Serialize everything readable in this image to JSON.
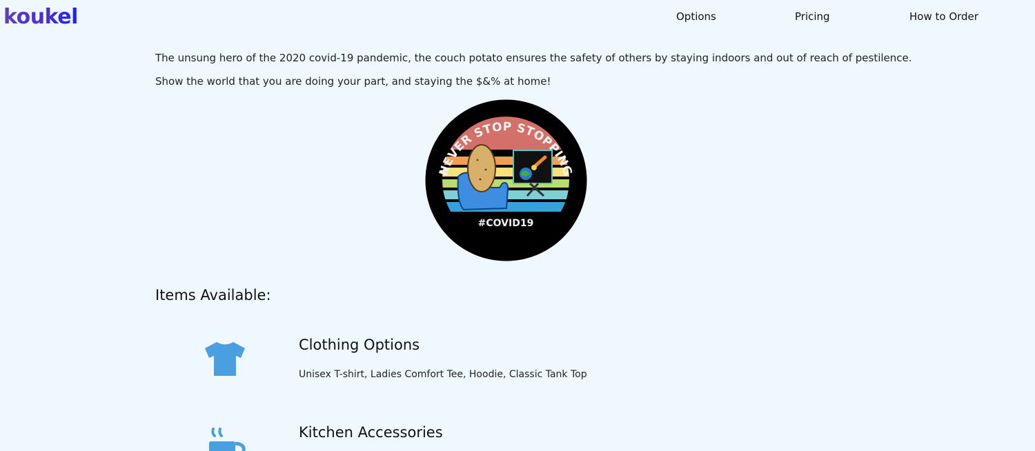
{
  "header": {
    "logo_text": "koukel",
    "nav": [
      "Options",
      "Pricing",
      "How to Order"
    ]
  },
  "intro": {
    "line1": "The unsung hero of the 2020 covid-19 pandemic, the couch potato ensures the safety of others by staying indoors and out of reach of pestilence.",
    "line2": "Show the world that you are doing your part, and staying the $&% at home!"
  },
  "badge": {
    "top_text": "NEVER STOP STOPPING",
    "bottom_text": "#COVID19"
  },
  "items_section": {
    "title": "Items Available:",
    "items": [
      {
        "icon": "tshirt-icon",
        "title": "Clothing Options",
        "description": "Unisex T-shirt, Ladies Comfort Tee, Hoodie, Classic Tank Top"
      },
      {
        "icon": "mug-icon",
        "title": "Kitchen Accessories",
        "description": ""
      }
    ]
  },
  "colors": {
    "background": "#f0f8ff",
    "icon_blue": "#4a9fe0",
    "logo_start": "#5a3fc0",
    "logo_end": "#1a22ff"
  }
}
